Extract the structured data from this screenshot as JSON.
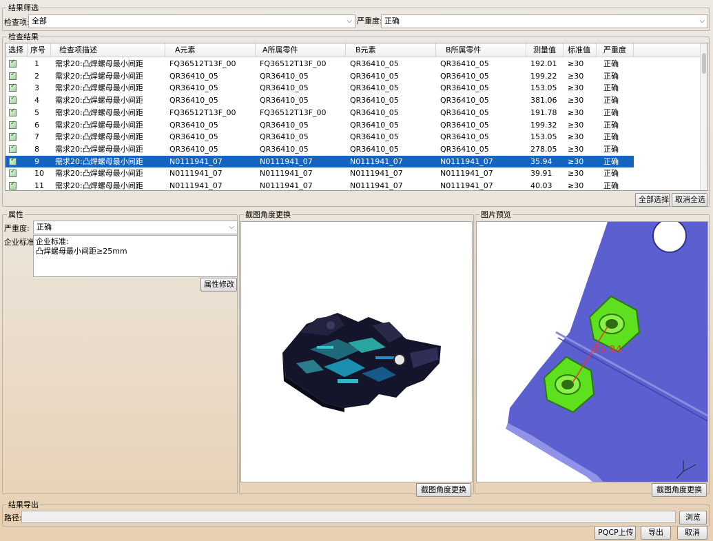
{
  "filter": {
    "legend": "结果筛选",
    "check_item_label": "检查项:",
    "check_item_value": "全部",
    "severity_label": "严重度:",
    "severity_value": "正确"
  },
  "results": {
    "legend": "检查结果",
    "columns": [
      "选择",
      "序号",
      "检查项描述",
      "A元素",
      "A所属零件",
      "B元素",
      "B所属零件",
      "测量值",
      "标准值",
      "严重度"
    ],
    "rows": [
      {
        "no": "1",
        "desc": "需求20:凸焊螺母最小间距",
        "a_elem": "FQ36512T13F_00",
        "a_part": "FQ36512T13F_00",
        "b_elem": "QR36410_05",
        "b_part": "QR36410_05",
        "measured": "192.01",
        "standard": "≥30",
        "severity": "正确",
        "selected": false
      },
      {
        "no": "2",
        "desc": "需求20:凸焊螺母最小间距",
        "a_elem": "QR36410_05",
        "a_part": "QR36410_05",
        "b_elem": "QR36410_05",
        "b_part": "QR36410_05",
        "measured": "199.22",
        "standard": "≥30",
        "severity": "正确",
        "selected": false
      },
      {
        "no": "3",
        "desc": "需求20:凸焊螺母最小间距",
        "a_elem": "QR36410_05",
        "a_part": "QR36410_05",
        "b_elem": "QR36410_05",
        "b_part": "QR36410_05",
        "measured": "153.05",
        "standard": "≥30",
        "severity": "正确",
        "selected": false
      },
      {
        "no": "4",
        "desc": "需求20:凸焊螺母最小间距",
        "a_elem": "QR36410_05",
        "a_part": "QR36410_05",
        "b_elem": "QR36410_05",
        "b_part": "QR36410_05",
        "measured": "381.06",
        "standard": "≥30",
        "severity": "正确",
        "selected": false
      },
      {
        "no": "5",
        "desc": "需求20:凸焊螺母最小间距",
        "a_elem": "FQ36512T13F_00",
        "a_part": "FQ36512T13F_00",
        "b_elem": "QR36410_05",
        "b_part": "QR36410_05",
        "measured": "191.78",
        "standard": "≥30",
        "severity": "正确",
        "selected": false
      },
      {
        "no": "6",
        "desc": "需求20:凸焊螺母最小间距",
        "a_elem": "QR36410_05",
        "a_part": "QR36410_05",
        "b_elem": "QR36410_05",
        "b_part": "QR36410_05",
        "measured": "199.32",
        "standard": "≥30",
        "severity": "正确",
        "selected": false
      },
      {
        "no": "7",
        "desc": "需求20:凸焊螺母最小间距",
        "a_elem": "QR36410_05",
        "a_part": "QR36410_05",
        "b_elem": "QR36410_05",
        "b_part": "QR36410_05",
        "measured": "153.05",
        "standard": "≥30",
        "severity": "正确",
        "selected": false
      },
      {
        "no": "8",
        "desc": "需求20:凸焊螺母最小间距",
        "a_elem": "QR36410_05",
        "a_part": "QR36410_05",
        "b_elem": "QR36410_05",
        "b_part": "QR36410_05",
        "measured": "278.05",
        "standard": "≥30",
        "severity": "正确",
        "selected": false
      },
      {
        "no": "9",
        "desc": "需求20:凸焊螺母最小间距",
        "a_elem": "N0111941_07",
        "a_part": "N0111941_07",
        "b_elem": "N0111941_07",
        "b_part": "N0111941_07",
        "measured": "35.94",
        "standard": "≥30",
        "severity": "正确",
        "selected": true
      },
      {
        "no": "10",
        "desc": "需求20:凸焊螺母最小间距",
        "a_elem": "N0111941_07",
        "a_part": "N0111941_07",
        "b_elem": "N0111941_07",
        "b_part": "N0111941_07",
        "measured": "39.91",
        "standard": "≥30",
        "severity": "正确",
        "selected": false
      },
      {
        "no": "11",
        "desc": "需求20:凸焊螺母最小间距",
        "a_elem": "N0111941_07",
        "a_part": "N0111941_07",
        "b_elem": "N0111941_07",
        "b_part": "N0111941_07",
        "measured": "40.03",
        "standard": "≥30",
        "severity": "正确",
        "selected": false
      }
    ],
    "select_all_label": "全部选择",
    "deselect_all_label": "取消全选"
  },
  "properties": {
    "legend": "属性",
    "severity_label": "严重度:",
    "severity_value": "正确",
    "standard_label": "企业标准:",
    "standard_text_line1": "企业标准:",
    "standard_text_line2": "凸焊螺母最小间距≥25mm",
    "modify_label": "属性修改"
  },
  "screenshot_panel": {
    "legend": "截图角度更换",
    "change_label": "截图角度更换"
  },
  "preview_panel": {
    "legend": "图片预览",
    "change_label": "截图角度更换",
    "measure_annotation": "35.94"
  },
  "export": {
    "legend": "结果导出",
    "path_label": "路径:",
    "path_value": "",
    "browse_label": "浏览",
    "pqcp_label": "PQCP上传",
    "export_label": "导出",
    "cancel_label": "取消"
  },
  "colors": {
    "selection": "#1565c0",
    "plate": "#5b5fcf",
    "nut": "#5fe01e",
    "annotation": "#e53935"
  }
}
